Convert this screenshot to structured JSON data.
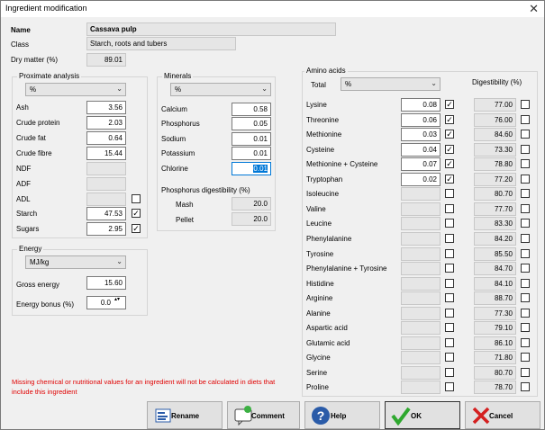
{
  "window": {
    "title": "Ingredient modification",
    "close_glyph": "✕"
  },
  "header": {
    "name_label": "Name",
    "name_value": "Cassava pulp",
    "class_label": "Class",
    "class_value": "Starch, roots and tubers",
    "dry_label": "Dry matter (%)",
    "dry_value": "89.01"
  },
  "proximate": {
    "title": "Proximate analysis",
    "unit": "%",
    "rows": [
      {
        "label": "Ash",
        "value": "3.56"
      },
      {
        "label": "Crude protein",
        "value": "2.03"
      },
      {
        "label": "Crude fat",
        "value": "0.64"
      },
      {
        "label": "Crude fibre",
        "value": "15.44"
      },
      {
        "label": "NDF",
        "value": ""
      },
      {
        "label": "ADF",
        "value": ""
      },
      {
        "label": "ADL",
        "value": ""
      },
      {
        "label": "Starch",
        "value": "47.53"
      },
      {
        "label": "Sugars",
        "value": "2.95"
      }
    ]
  },
  "energy": {
    "title": "Energy",
    "unit": "MJ/kg",
    "gross_label": "Gross energy",
    "gross_value": "15.60",
    "bonus_label": "Energy bonus (%)",
    "bonus_value": "0.0"
  },
  "minerals": {
    "title": "Minerals",
    "unit": "%",
    "rows": [
      {
        "label": "Calcium",
        "value": "0.58"
      },
      {
        "label": "Phosphorus",
        "value": "0.05"
      },
      {
        "label": "Sodium",
        "value": "0.01"
      },
      {
        "label": "Potassium",
        "value": "0.01"
      },
      {
        "label": "Chlorine",
        "value": "0.01"
      }
    ],
    "pdig_title": "Phosphorus digestibility (%)",
    "mash_label": "Mash",
    "mash_value": "20.0",
    "pellet_label": "Pellet",
    "pellet_value": "20.0"
  },
  "amino": {
    "title": "Amino acids",
    "total_label": "Total",
    "unit": "%",
    "dig_title": "Digestibility (%)",
    "rows": [
      {
        "label": "Lysine",
        "value": "0.08",
        "checked": true,
        "dig": "77.00"
      },
      {
        "label": "Threonine",
        "value": "0.06",
        "checked": true,
        "dig": "76.00"
      },
      {
        "label": "Methionine",
        "value": "0.03",
        "checked": true,
        "dig": "84.60"
      },
      {
        "label": "Cysteine",
        "value": "0.04",
        "checked": true,
        "dig": "73.30"
      },
      {
        "label": "Methionine + Cysteine",
        "value": "0.07",
        "checked": true,
        "dig": "78.80"
      },
      {
        "label": "Tryptophan",
        "value": "0.02",
        "checked": true,
        "dig": "77.20"
      },
      {
        "label": "Isoleucine",
        "value": "",
        "checked": false,
        "dig": "80.70"
      },
      {
        "label": "Valine",
        "value": "",
        "checked": false,
        "dig": "77.70"
      },
      {
        "label": "Leucine",
        "value": "",
        "checked": false,
        "dig": "83.30"
      },
      {
        "label": "Phenylalanine",
        "value": "",
        "checked": false,
        "dig": "84.20"
      },
      {
        "label": "Tyrosine",
        "value": "",
        "checked": false,
        "dig": "85.50"
      },
      {
        "label": "Phenylalanine + Tyrosine",
        "value": "",
        "checked": false,
        "dig": "84.70"
      },
      {
        "label": "Histidine",
        "value": "",
        "checked": false,
        "dig": "84.10"
      },
      {
        "label": "Arginine",
        "value": "",
        "checked": false,
        "dig": "88.70"
      },
      {
        "label": "Alanine",
        "value": "",
        "checked": false,
        "dig": "77.30"
      },
      {
        "label": "Aspartic acid",
        "value": "",
        "checked": false,
        "dig": "79.10"
      },
      {
        "label": "Glutamic acid",
        "value": "",
        "checked": false,
        "dig": "86.10"
      },
      {
        "label": "Glycine",
        "value": "",
        "checked": false,
        "dig": "71.80"
      },
      {
        "label": "Serine",
        "value": "",
        "checked": false,
        "dig": "80.70"
      },
      {
        "label": "Proline",
        "value": "",
        "checked": false,
        "dig": "78.70"
      }
    ]
  },
  "warning": "Missing chemical or nutritional values for an ingredient will not be calculated in diets that include this ingredient",
  "buttons": {
    "rename": "Rename",
    "comment": "Comment",
    "help": "Help",
    "ok": "OK",
    "cancel": "Cancel"
  },
  "icons": {
    "check": "✓",
    "dropdown": "⌄",
    "spin": "▴▾"
  }
}
